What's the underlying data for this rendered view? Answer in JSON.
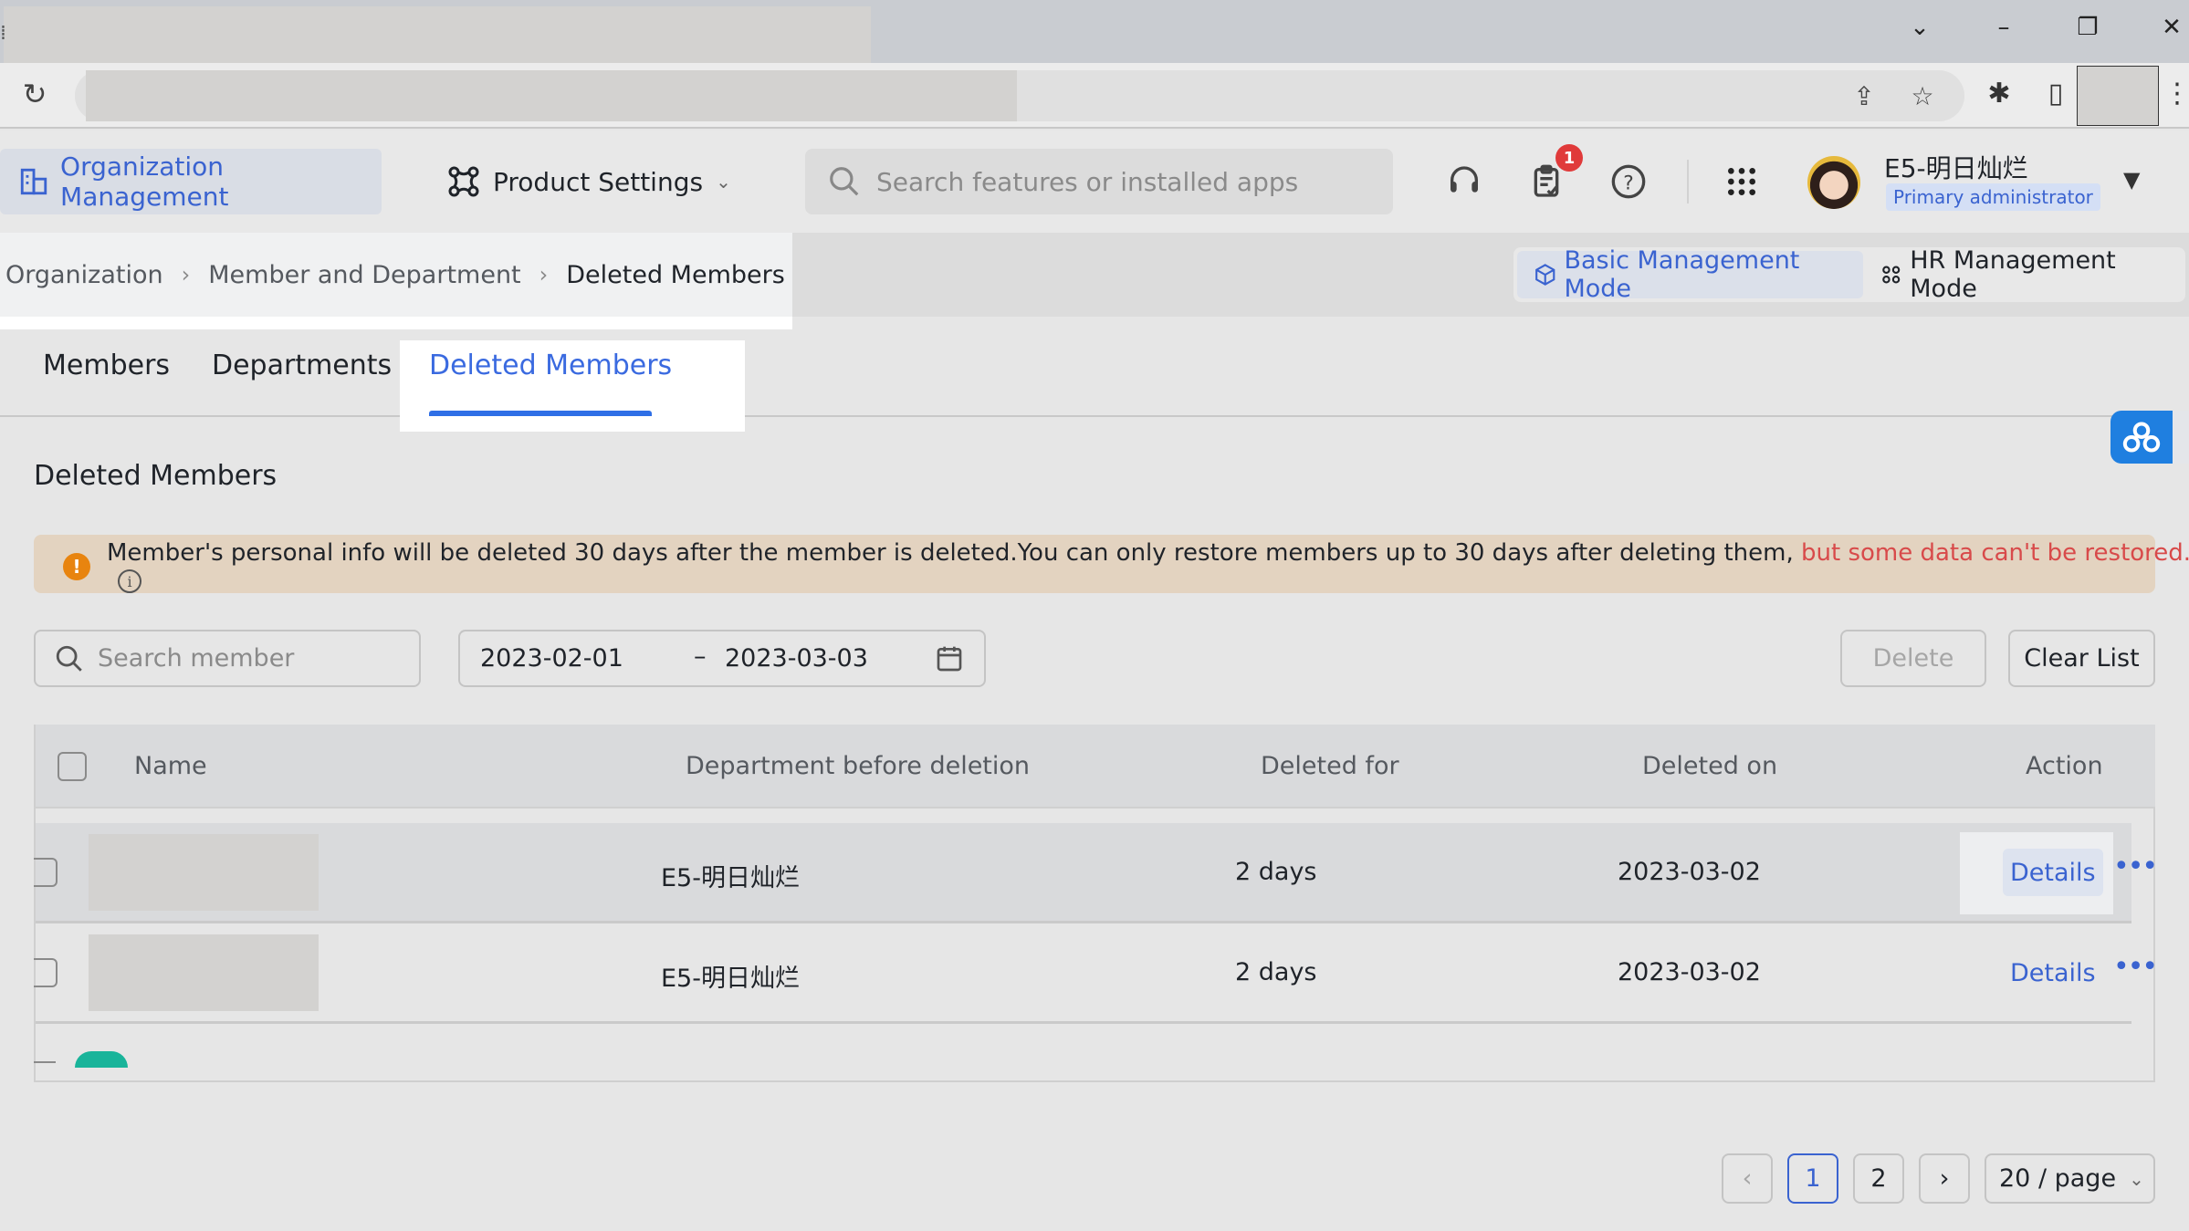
{
  "browser": {
    "window_controls": {
      "tab_list": "⌄",
      "minimize": "–",
      "restore": "❐",
      "close": "✕"
    },
    "reload_icon": "↻",
    "omnibox_icons": {
      "share": "⇪",
      "bookmark": "☆"
    },
    "toolbar_icons": {
      "extensions": "✱",
      "side_panel": "▯",
      "menu": "⋮"
    }
  },
  "header": {
    "org_management_label": "Organization Management",
    "product_settings_label": "Product Settings",
    "search_placeholder": "Search features or installed apps",
    "notification_count": "1",
    "user": {
      "name": "E5-明日灿烂",
      "role": "Primary administrator"
    }
  },
  "breadcrumb": {
    "items": [
      "Organization",
      "Member and Department",
      "Deleted Members"
    ],
    "separator": "›"
  },
  "mode_switch": {
    "basic": "Basic Management Mode",
    "hr": "HR Management Mode",
    "active": "basic"
  },
  "tabs": [
    {
      "label": "Members",
      "active": false
    },
    {
      "label": "Departments",
      "active": false
    },
    {
      "label": "Deleted Members",
      "active": true
    }
  ],
  "section_title": "Deleted Members",
  "alert": {
    "icon": "!",
    "text": "Member's personal info will be deleted 30 days after the member is deleted.You can only restore members up to 30 days after deleting them, ",
    "warning_text": "but some data can't be restored.",
    "info_icon": "i",
    "accent_color": "#e8840f",
    "warning_color": "#d84a4a"
  },
  "filters": {
    "search_placeholder": "Search member",
    "date_start": "2023-02-01",
    "date_separator": "–",
    "date_end": "2023-03-03",
    "delete_label": "Delete",
    "clear_list_label": "Clear List"
  },
  "table": {
    "columns": [
      "Name",
      "Department before deletion",
      "Deleted for",
      "Deleted on",
      "Action"
    ],
    "rows": [
      {
        "name": "",
        "department": "E5-明日灿烂",
        "deleted_for": "2 days",
        "deleted_on": "2023-03-02",
        "action": "Details",
        "more": "•••"
      },
      {
        "name": "",
        "department": "E5-明日灿烂",
        "deleted_for": "2 days",
        "deleted_on": "2023-03-02",
        "action": "Details",
        "more": "•••"
      }
    ]
  },
  "pagination": {
    "prev": "‹",
    "pages": [
      "1",
      "2"
    ],
    "current_page": "1",
    "next": "›",
    "page_size": "20 / page",
    "page_size_caret": "⌄"
  },
  "colors": {
    "brand_blue": "#3a63d0",
    "tab_ink": "#2f6fe6",
    "badge_red": "#e03a3a"
  }
}
